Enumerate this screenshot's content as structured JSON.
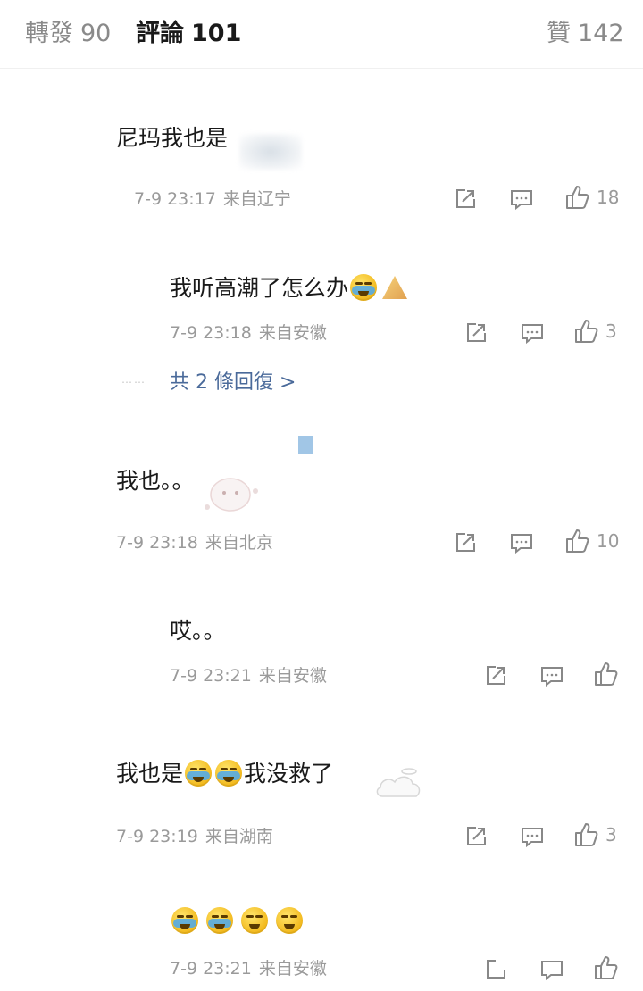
{
  "tabs": [
    {
      "label": "轉發",
      "count": "90"
    },
    {
      "label": "評論",
      "count": "101"
    },
    {
      "label": "贊",
      "count": "142"
    }
  ],
  "comments": [
    {
      "text": "尼玛我也是",
      "date": "7-9 23:17",
      "location": "来自辽宁",
      "likes": "18"
    },
    {
      "text": "我听高潮了怎么办",
      "date": "7-9 23:18",
      "location": "来自安徽",
      "likes": "3"
    },
    {
      "text": "我也。。",
      "date": "7-9 23:18",
      "location": "来自北京",
      "likes": "10"
    },
    {
      "text": "哎。。",
      "date": "7-9 23:21",
      "location": "来自安徽",
      "likes": ""
    },
    {
      "text_a": "我也是",
      "text_b": "我没救了",
      "date": "7-9 23:19",
      "location": "来自湖南",
      "likes": "3"
    },
    {
      "text": "",
      "date": "7-9 23:21",
      "location": "来自安徽",
      "likes": ""
    }
  ],
  "replies_link": "共 2 條回復 >",
  "icons": {
    "repost": "repost-icon",
    "comment": "comment-icon",
    "like": "thumbs-up-icon",
    "emoji_crying": "crying-laughing-emoji",
    "emoji_sob": "sobbing-emoji"
  },
  "colors": {
    "accent_link": "#4a6a9a",
    "muted": "#9a9a9a"
  }
}
